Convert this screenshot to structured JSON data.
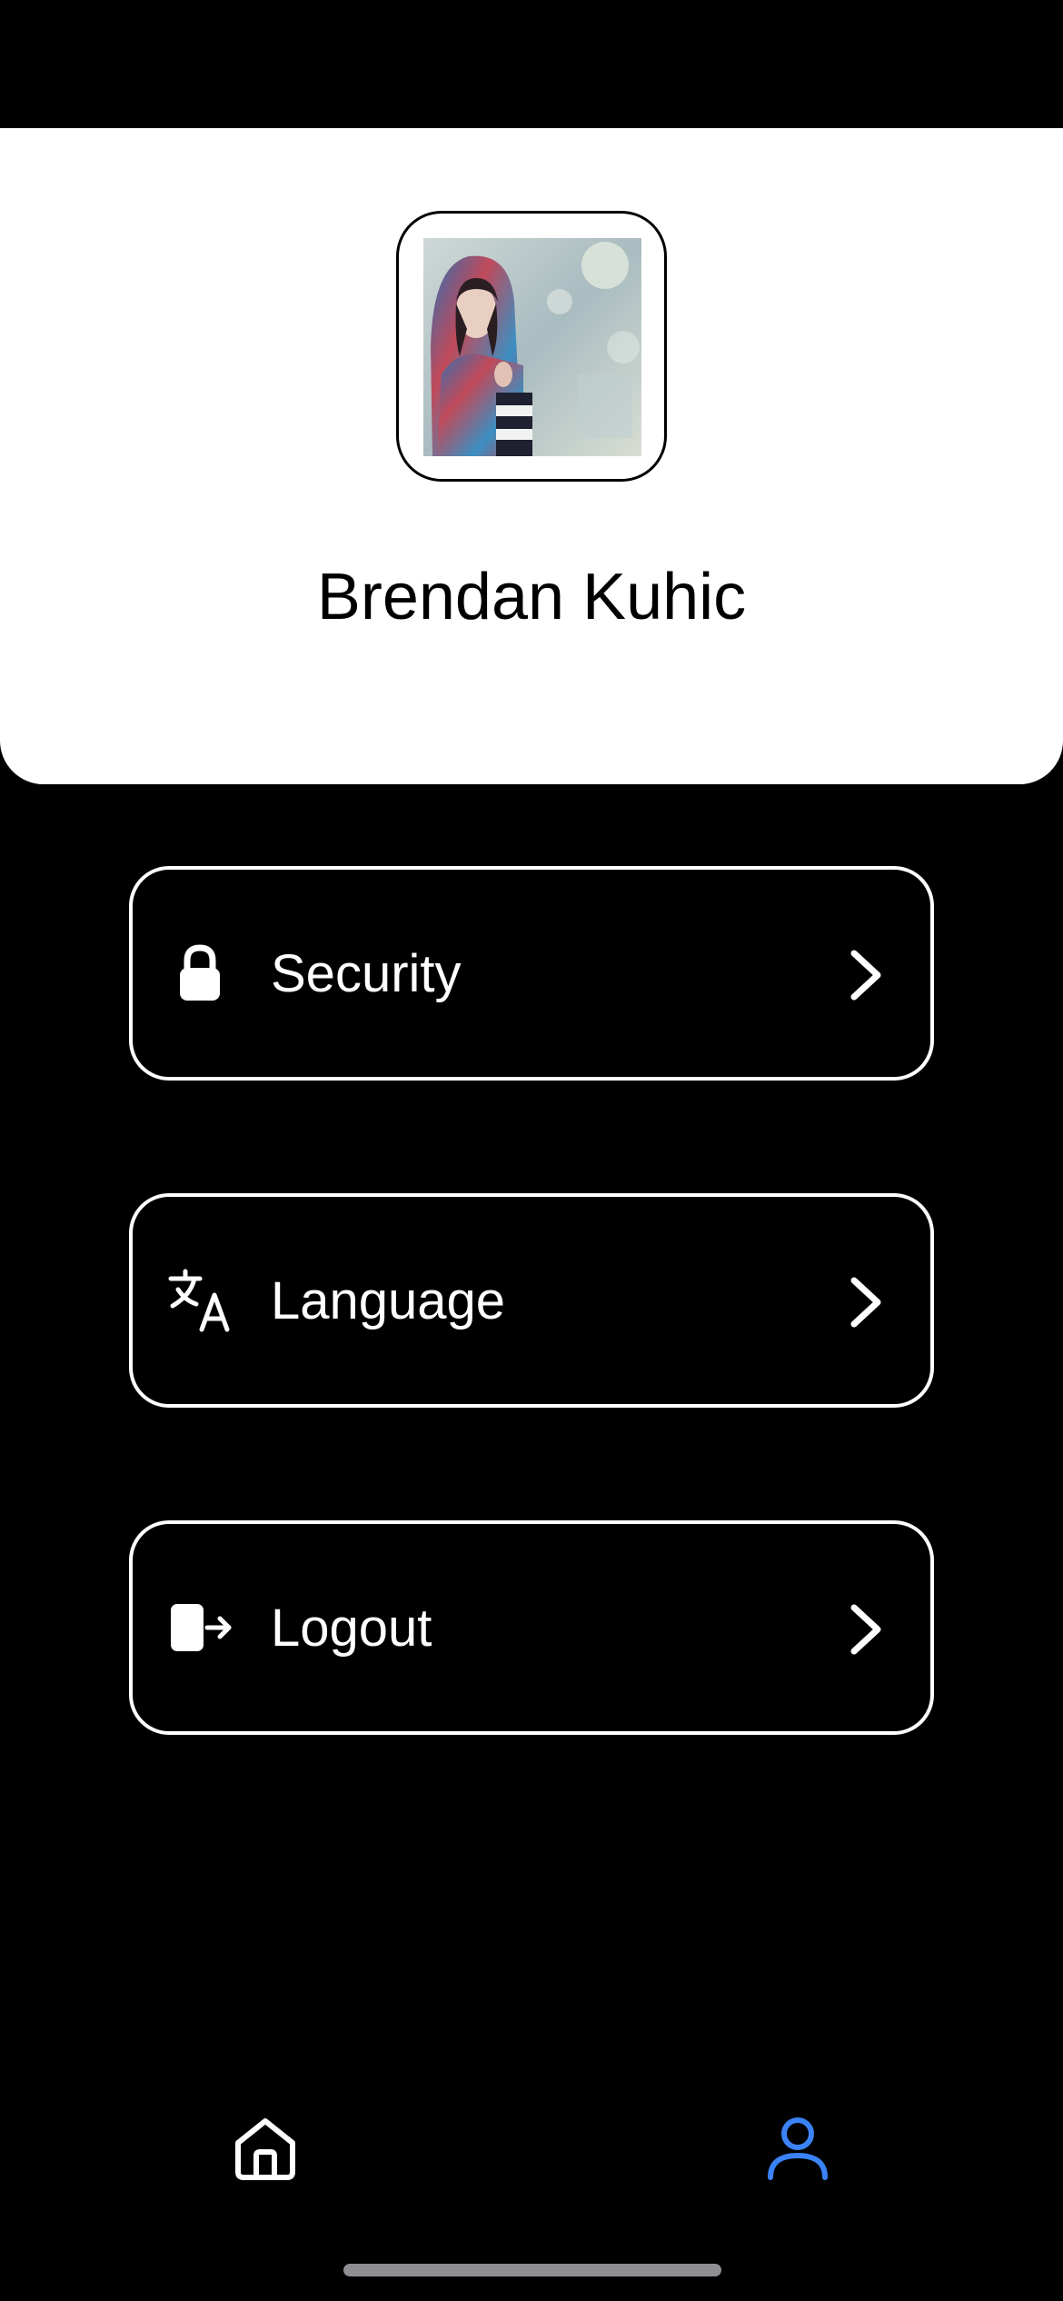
{
  "profile": {
    "name": "Brendan Kuhic"
  },
  "menu": {
    "items": [
      {
        "id": "security",
        "label": "Security",
        "icon": "lock-icon"
      },
      {
        "id": "language",
        "label": "Language",
        "icon": "translate-icon"
      },
      {
        "id": "logout",
        "label": "Logout",
        "icon": "logout-icon"
      }
    ]
  },
  "bottom_nav": {
    "items": [
      {
        "id": "home",
        "icon": "home-icon",
        "active": false
      },
      {
        "id": "profile",
        "icon": "user-icon",
        "active": true
      }
    ]
  },
  "colors": {
    "background": "#000000",
    "card": "#ffffff",
    "accent": "#3b82f6",
    "text_light": "#ffffff",
    "text_dark": "#000000"
  }
}
